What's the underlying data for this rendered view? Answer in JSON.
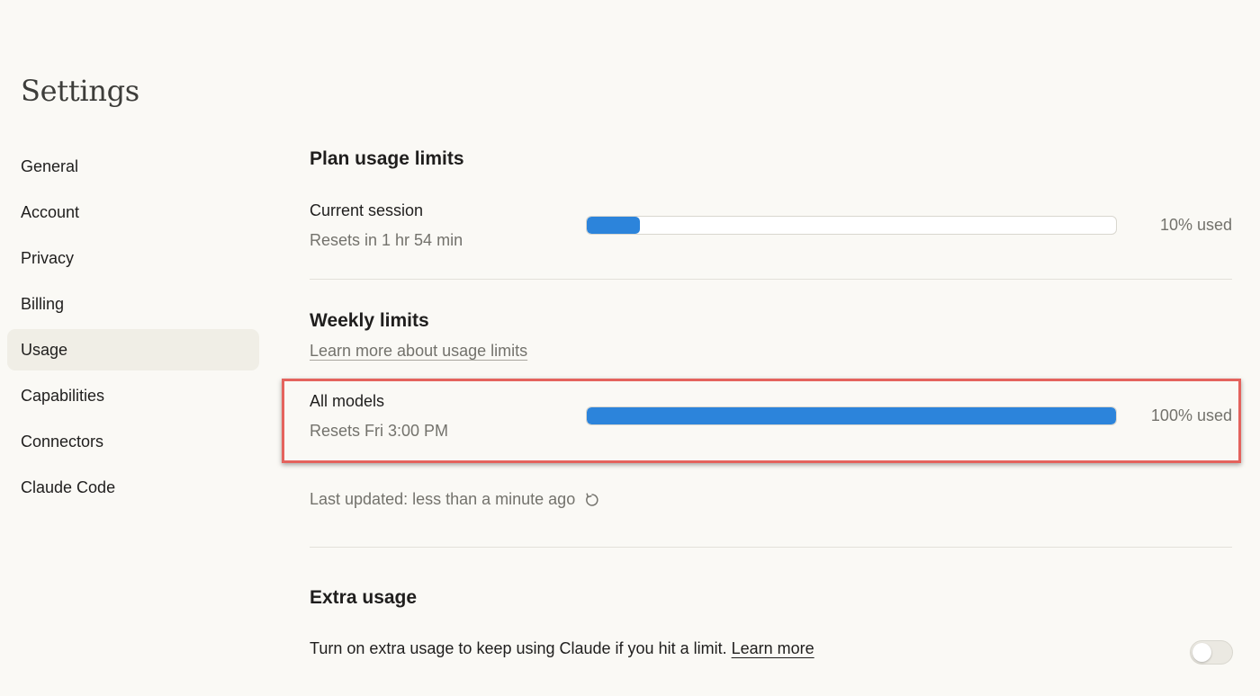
{
  "page": {
    "title": "Settings"
  },
  "sidebar": {
    "items": [
      {
        "label": "General"
      },
      {
        "label": "Account"
      },
      {
        "label": "Privacy"
      },
      {
        "label": "Billing"
      },
      {
        "label": "Usage",
        "active": true
      },
      {
        "label": "Capabilities"
      },
      {
        "label": "Connectors"
      },
      {
        "label": "Claude Code"
      }
    ]
  },
  "plan_usage": {
    "heading": "Plan usage limits",
    "current_session": {
      "label": "Current session",
      "reset": "Resets in 1 hr 54 min",
      "percent": 10,
      "percent_text": "10% used"
    }
  },
  "weekly": {
    "heading": "Weekly limits",
    "learn_more": "Learn more about usage limits",
    "all_models": {
      "label": "All models",
      "reset": "Resets Fri 3:00 PM",
      "percent": 100,
      "percent_text": "100% used"
    },
    "last_updated": "Last updated: less than a minute ago"
  },
  "extra_usage": {
    "heading": "Extra usage",
    "description": "Turn on extra usage to keep using Claude if you hit a limit.",
    "learn_more": "Learn more",
    "enabled": false
  },
  "colors": {
    "accent": "#2c84db",
    "highlight": "#e4635d",
    "background": "#faf9f5"
  },
  "icons": {
    "refresh": "refresh-icon"
  }
}
